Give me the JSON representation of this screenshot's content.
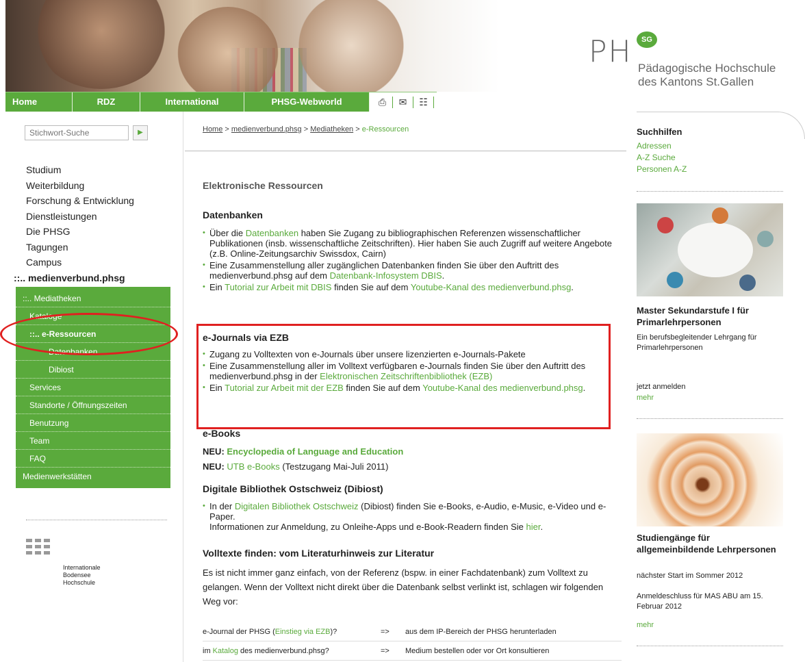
{
  "header": {
    "topnav": [
      "Home",
      "RDZ",
      "International",
      "PHSG-Webworld"
    ],
    "icons": [
      "print-icon",
      "mail-icon",
      "sitemap-icon"
    ],
    "logo": {
      "ph": "PH",
      "badge": "SG",
      "line1": "Pädagogische Hochschule",
      "line2": "des Kantons St.Gallen"
    }
  },
  "search": {
    "placeholder": "Stichwort-Suche"
  },
  "mainnav": [
    "Studium",
    "Weiterbildung",
    "Forschung & Entwicklung",
    "Dienstleistungen",
    "Die PHSG",
    "Tagungen",
    "Campus",
    "::.. medienverbund.phsg"
  ],
  "subnav": [
    {
      "label": "::.. Mediatheken",
      "level": 0
    },
    {
      "label": "Kataloge",
      "level": 1
    },
    {
      "label": "::.. e-Ressourcen",
      "level": 1
    },
    {
      "label": "Datenbanken",
      "level": 2
    },
    {
      "label": "Dibiost",
      "level": 2
    },
    {
      "label": "Services",
      "level": 1
    },
    {
      "label": "Standorte / Öffnungszeiten",
      "level": 1
    },
    {
      "label": "Benutzung",
      "level": 1
    },
    {
      "label": "Team",
      "level": 1
    },
    {
      "label": "FAQ",
      "level": 1
    },
    {
      "label": "Medienwerkstätten",
      "level": 0
    }
  ],
  "ibh": {
    "l1": "Internationale",
    "l2": "Bodensee",
    "l3": "Hochschule"
  },
  "breadcrumb": {
    "home": "Home",
    "sep": " > ",
    "mv": "medienverbund.phsg",
    "med": "Mediatheken",
    "cur": "e-Ressourcen"
  },
  "page_title": "Elektronische Ressourcen",
  "datenbanken": {
    "title": "Datenbanken",
    "b1a": "Über die ",
    "b1link": "Datenbanken",
    "b1b": " haben Sie Zugang zu bibliographischen Referenzen wissenschaftlicher Publikationen (insb. wissenschaftliche Zeitschriften). Hier haben Sie auch Zugriff auf weitere Angebote (z.B. Online-Zeitungsarchiv Swissdox, Cairn)",
    "b2a": "Eine Zusammenstellung aller zugänglichen Datenbanken finden Sie über den Auftritt des medienverbund.phsg auf dem ",
    "b2link": "Datenbank-Infosystem DBIS",
    "b2b": ".",
    "b3a": "Ein ",
    "b3link": "Tutorial zur Arbeit mit DBIS",
    "b3b": " finden Sie auf dem ",
    "b3link2": "Youtube-Kanal des medienverbund.phsg",
    "b3c": "."
  },
  "ejournals": {
    "title": "e-Journals via EZB",
    "b1": "Zugang zu Volltexten von e-Journals über unsere lizenzierten e-Journals-Pakete",
    "b2a": "Eine Zusammenstellung aller im Volltext verfügbaren e-Journals finden Sie über den Auftritt des medienverbund.phsg in der ",
    "b2link": "Elektronischen Zeitschriftenbibliothek (EZB)",
    "b3a": "Ein ",
    "b3link": "Tutorial zur Arbeit mit der EZB",
    "b3b": " finden Sie auf dem ",
    "b3link2": "Youtube-Kanal des medienverbund.phsg",
    "b3c": "."
  },
  "ebooks": {
    "title": "e-Books",
    "l1pre": "NEU: ",
    "l1link": "Encyclopedia of Language and Education",
    "l2pre": "NEU: ",
    "l2link": "UTB e-Books",
    "l2post": " (Testzugang Mai-Juli 2011)"
  },
  "dibiost": {
    "title": "Digitale Bibliothek Ostschweiz (Dibiost)",
    "a": "In der ",
    "link": "Digitalen Bibliothek Ostschweiz",
    "b": " (Dibiost) finden Sie e-Books, e-Audio, e-Music, e-Video und e-Paper.",
    "c": "Informationen zur Anmeldung, zu Onleihe-Apps und e-Book-Readern finden Sie ",
    "link2": "hier",
    "d": "."
  },
  "volltexte": {
    "title": "Volltexte finden: vom Literaturhinweis zur Literatur",
    "text": "Es ist nicht immer ganz einfach, von der Referenz (bspw. in einer Fachdatenbank) zum Volltext zu gelangen. Wenn der Volltext nicht direkt über die Datenbank selbst verlinkt ist, schlagen wir folgenden Weg vor:"
  },
  "vtable": {
    "r1c1a": "e-Journal der PHSG (",
    "r1c1link": "Einstieg via EZB",
    "r1c1b": ")?",
    "r1c2": "=>",
    "r1c3": "aus dem IP-Bereich der PHSG herunterladen",
    "r2c1a": "im ",
    "r2c1link": "Katalog",
    "r2c1b": " des medienverbund.phsg?",
    "r2c2": "=>",
    "r2c3": "Medium bestellen oder vor Ort konsultieren"
  },
  "right": {
    "suchhilfen_title": "Suchhilfen",
    "suchhilfen": [
      "Adressen",
      "A-Z Suche",
      "Personen A-Z"
    ],
    "master_title": "Master Sekundarstufe I für Primarlehrpersonen",
    "master_text": "Ein berufsbegleitender Lehrgang für Primarlehrpersonen",
    "master_cta": "jetzt anmelden",
    "master_more": "mehr",
    "stud_title": "Studiengänge für allgemeinbildende Lehrpersonen",
    "stud_l1": "nächster Start im Sommer 2012",
    "stud_l2": "Anmeldeschluss für MAS ABU am 15. Februar 2012",
    "stud_more": "mehr"
  }
}
